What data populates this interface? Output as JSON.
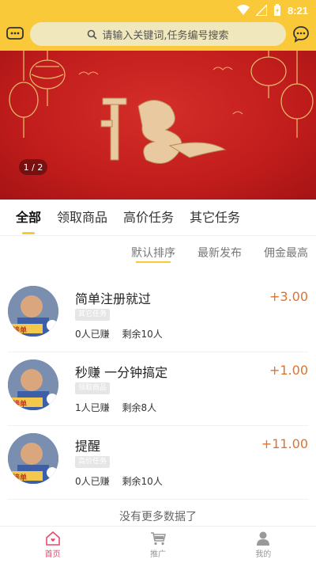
{
  "status_bar": {
    "time": "8:21"
  },
  "search": {
    "placeholder": "请输入关键词,任务编号搜索"
  },
  "banner": {
    "pager": "1 / 2"
  },
  "tabs": [
    "全部",
    "领取商品",
    "高价任务",
    "其它任务"
  ],
  "sort": [
    "默认排序",
    "最新发布",
    "佣金最高"
  ],
  "tasks": [
    {
      "title": "简单注册就过",
      "badge": "其它任务",
      "earned": "0人已赚",
      "remaining": "剩余10人",
      "price": "+3.00",
      "avatar_text": "接单"
    },
    {
      "title": "秒赚 一分钟搞定",
      "badge": "领取商品",
      "earned": "1人已赚",
      "remaining": "剩余8人",
      "price": "+1.00",
      "avatar_text": "接单"
    },
    {
      "title": "提醒",
      "badge": "高价任务",
      "earned": "0人已赚",
      "remaining": "剩余10人",
      "price": "+11.00",
      "avatar_text": "接单"
    }
  ],
  "no_more": "没有更多数据了",
  "bottom_nav": [
    {
      "label": "首页",
      "icon": "home-icon",
      "active": true
    },
    {
      "label": "推广",
      "icon": "cart-icon",
      "active": false
    },
    {
      "label": "我的",
      "icon": "person-icon",
      "active": false
    }
  ],
  "colors": {
    "accent": "#f9c93a",
    "price": "#e0722d",
    "nav_active": "#e84a6b",
    "banner": "#c11d1c"
  }
}
